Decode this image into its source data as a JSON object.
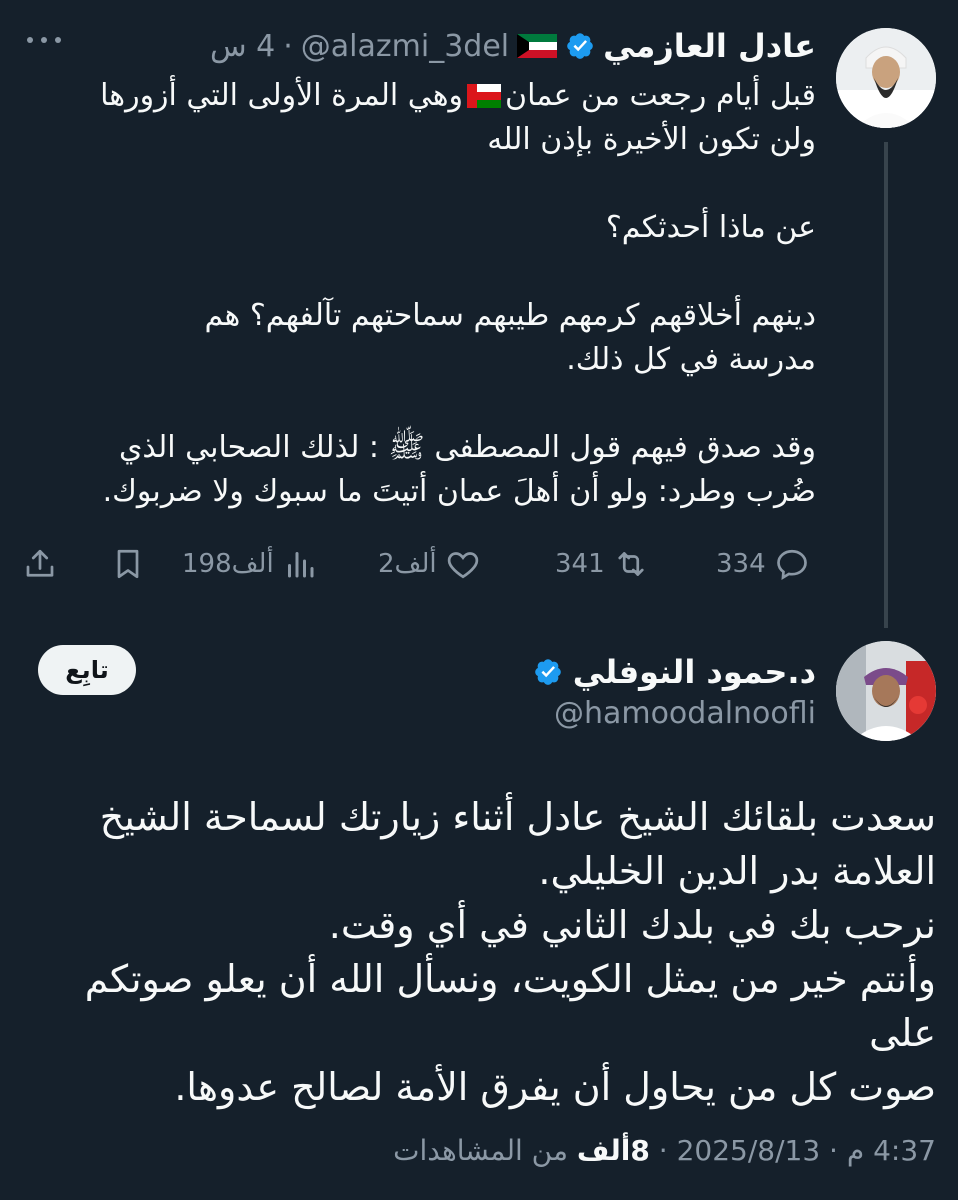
{
  "original_tweet": {
    "author_name": "عادل العازمي",
    "handle": "@alazmi_3del",
    "separator": "·",
    "time": "4 س",
    "body_lines": [
      "قبل أيام رجعت من عمان 🇴🇲 وهي المرة الأولى التي أزورها",
      "ولن تكون الأخيرة بإذن الله",
      "",
      "عن ماذا أحدثكم؟",
      "",
      "دينهم أخلاقهم كرمهم طيبهم سماحتهم تآلفهم؟ هم",
      "مدرسة في كل ذلك.",
      "",
      "وقد صدق فيهم قول المصطفى ﷺ : لذلك الصحابي الذي",
      "ضُرب وطرد: ولو أن أهلَ عمان أتيتَ ما سبوك ولا ضربوك."
    ],
    "actions": {
      "replies": "334",
      "retweets": "341",
      "likes": "2ألف",
      "views": "198ألف"
    },
    "icons": [
      "verified-badge-icon",
      "kuwait-flag-icon",
      "oman-flag-icon",
      "more-icon",
      "reply-icon",
      "retweet-icon",
      "like-icon",
      "views-icon",
      "bookmark-icon",
      "share-icon"
    ]
  },
  "reply_tweet": {
    "author_name": "د.حمود النوفلي",
    "handle": "@hamoodalnoofli",
    "follow_label": "تابِع",
    "body_lines": [
      "سعدت بلقائك الشيخ عادل أثناء زيارتك لسماحة الشيخ",
      "العلامة بدر الدين الخليلي.",
      "نرحب بك في بلدك الثاني في أي وقت.",
      "وأنتم خير من يمثل الكويت، ونسأل الله أن يعلو صوتكم على",
      "صوت كل من يحاول أن يفرق الأمة لصالح عدوها."
    ],
    "time": "4:37 م",
    "date": "2025/8/13",
    "views_count": "8ألف",
    "views_label": "من المشاهدات",
    "separator": "·"
  },
  "colors": {
    "background": "#15202b",
    "text": "#f7f9f9",
    "secondary_text": "#8b98a5",
    "verified_blue": "#1d9bf0",
    "thread_line": "#38444d"
  }
}
